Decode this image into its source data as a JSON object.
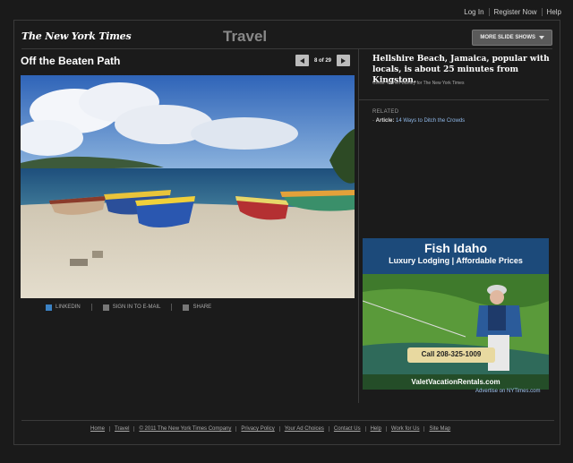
{
  "topnav": {
    "login": "Log In",
    "register": "Register Now",
    "help": "Help"
  },
  "masthead": {
    "logo": "The New York Times",
    "section": "Travel",
    "more_button": "MORE SLIDE SHOWS"
  },
  "slideshow": {
    "title": "Off the Beaten Path",
    "counter": "8 of 29",
    "caption": "Hellshire Beach, Jamaica, popular with locals, is about 25 minutes from Kingston.",
    "credit": "Credit: Marvin Bartley for The New York Times"
  },
  "share": {
    "linkedin": "LINKEDIN",
    "email": "SIGN IN TO E-MAIL",
    "share": "SHARE"
  },
  "related": {
    "heading": "RELATED",
    "items": [
      {
        "type": "Article:",
        "link": "14 Ways to Ditch the Crowds"
      }
    ]
  },
  "ad": {
    "title": "Fish Idaho",
    "subtitle": "Luxury Lodging | Affordable Prices",
    "phone": "Call 208-325-1009",
    "url": "ValetVacationRentals.com",
    "note": "Advertise on NYTimes.com"
  },
  "footer": {
    "links": [
      "Home",
      "Travel",
      "© 2011 The New York Times Company",
      "Privacy Policy",
      "Your Ad Choices",
      "Contact Us",
      "Help",
      "Work for Us",
      "Site Map"
    ]
  },
  "colors": {
    "background": "#1a1a1a",
    "link_blue": "#8fb8e8",
    "ad_blue": "#1c4a7a"
  },
  "icons": {
    "prev": "arrow-left-icon",
    "next": "arrow-right-icon",
    "linkedin": "linkedin-icon",
    "email": "email-icon",
    "share": "plus-icon",
    "more_caret": "chevron-down-icon"
  }
}
